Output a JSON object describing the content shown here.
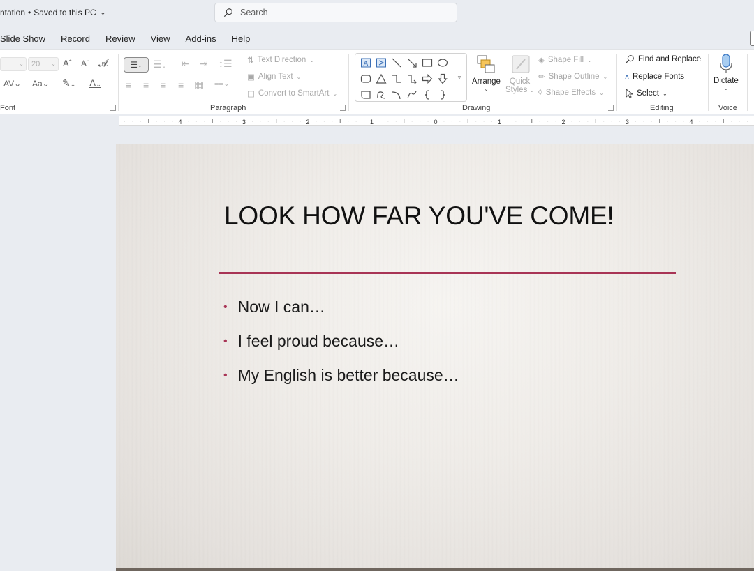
{
  "titlebar": {
    "doc_title": "ntation",
    "saved_status": "Saved to this PC",
    "search_placeholder": "Search"
  },
  "tabs": [
    "Slide Show",
    "Record",
    "Review",
    "View",
    "Add-ins",
    "Help"
  ],
  "ribbon": {
    "font": {
      "label": "Font",
      "size_value": "20"
    },
    "paragraph": {
      "label": "Paragraph",
      "text_direction": "Text Direction",
      "align_text": "Align Text",
      "convert_smartart": "Convert to SmartArt"
    },
    "drawing": {
      "label": "Drawing",
      "arrange": "Arrange",
      "quick_styles_1": "Quick",
      "quick_styles_2": "Styles",
      "shape_fill": "Shape Fill",
      "shape_outline": "Shape Outline",
      "shape_effects": "Shape Effects"
    },
    "editing": {
      "label": "Editing",
      "find_replace": "Find and Replace",
      "replace_fonts": "Replace Fonts",
      "select": "Select"
    },
    "voice": {
      "label": "Voice",
      "dictate": "Dictate"
    }
  },
  "ruler": {
    "labels": [
      "4",
      "3",
      "2",
      "1",
      "0",
      "1",
      "2",
      "3",
      "4"
    ]
  },
  "slide": {
    "title": "LOOK HOW FAR YOU'VE COME!",
    "bullets": [
      "Now I can…",
      "I feel proud because…",
      "My English is better because…"
    ],
    "accent_color": "#a83455"
  }
}
